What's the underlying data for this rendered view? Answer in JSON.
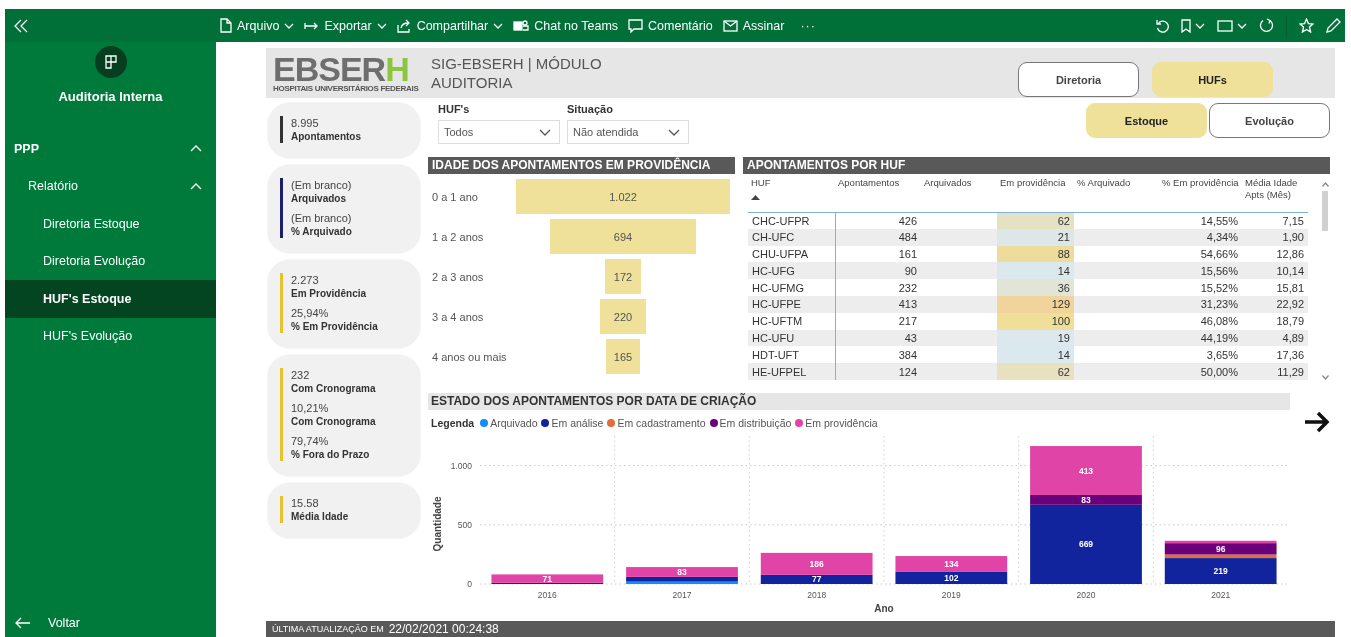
{
  "toolbar": {
    "menus": [
      {
        "kind": "file",
        "label": "Arquivo",
        "dropdown": true
      },
      {
        "kind": "export",
        "label": "Exportar",
        "dropdown": true
      },
      {
        "kind": "share",
        "label": "Compartilhar",
        "dropdown": true
      },
      {
        "kind": "teams",
        "label": "Chat no Teams",
        "dropdown": false
      },
      {
        "kind": "comment",
        "label": "Comentário",
        "dropdown": false
      },
      {
        "kind": "sign",
        "label": "Assinar",
        "dropdown": false
      }
    ],
    "more": "···"
  },
  "sidebar": {
    "title": "Auditoria Interna",
    "nav": [
      {
        "label": "PPP",
        "expanded": true,
        "children": [
          {
            "label": "Relatório",
            "expanded": true,
            "children": [
              {
                "label": "Diretoria Estoque",
                "selected": false
              },
              {
                "label": "Diretoria Evolução",
                "selected": false
              },
              {
                "label": "HUF's Estoque",
                "selected": true
              },
              {
                "label": "HUF's Evolução",
                "selected": false
              }
            ]
          }
        ]
      }
    ],
    "back": "Voltar"
  },
  "report": {
    "header": {
      "logo": {
        "text": "EBSER",
        "accent": "H",
        "subtitle": "HOSPITAIS UNIVERSITÁRIOS FEDERAIS"
      },
      "title": "SIG-EBSERH | MÓDULO AUDITORIA",
      "nav_buttons": [
        {
          "label": "Diretoria",
          "selected": false
        },
        {
          "label": "HUFs",
          "selected": true
        }
      ]
    },
    "cards": [
      {
        "color": "#333333",
        "metrics": [
          {
            "value": "8.995",
            "label": "Apontamentos"
          }
        ]
      },
      {
        "color": "#1c1f6b",
        "metrics": [
          {
            "value": "(Em branco)",
            "label": "Arquivados"
          },
          {
            "value": "(Em branco)",
            "label": "% Arquivado"
          }
        ]
      },
      {
        "color": "#e8c22c",
        "metrics": [
          {
            "value": "2.273",
            "label": "Em Providência"
          },
          {
            "value": "25,94%",
            "label": "% Em Providência"
          }
        ]
      },
      {
        "color": "#e8c22c",
        "metrics": [
          {
            "value": "232",
            "label": "Com Cronograma"
          },
          {
            "value": "10,21%",
            "label": "Com Cronograma"
          },
          {
            "value": "79,74%",
            "label": "% Fora do Prazo"
          }
        ]
      },
      {
        "color": "#e8c22c",
        "metrics": [
          {
            "value": "15.58",
            "label": "Média Idade"
          }
        ]
      }
    ],
    "filters": [
      {
        "label": "HUF's",
        "value": "Todos"
      },
      {
        "label": "Situação",
        "value": "Não atendida"
      }
    ],
    "view_toggle": [
      {
        "label": "Estoque",
        "selected": true
      },
      {
        "label": "Evolução",
        "selected": false
      }
    ],
    "funnel": {
      "title": "IDADE DOS APONTAMENTOS EM PROVIDÊNCIA",
      "stages": [
        {
          "label": "0 a 1 ano",
          "value": "1.022"
        },
        {
          "label": "1 a 2 anos",
          "value": "694"
        },
        {
          "label": "2 a 3 anos",
          "value": "172"
        },
        {
          "label": "3 a 4 anos",
          "value": "220"
        },
        {
          "label": "4 anos ou mais",
          "value": "165"
        }
      ]
    },
    "table": {
      "title": "APONTAMENTOS POR HUF",
      "columns": [
        {
          "label": "HUF",
          "sorted": true
        },
        {
          "label": "Apontamentos",
          "sorted": false
        },
        {
          "label": "Arquivados",
          "sorted": false
        },
        {
          "label": "Em providência",
          "sorted": false
        },
        {
          "label": "% Arquivado",
          "sorted": false
        },
        {
          "label": "% Em providência",
          "sorted": false
        },
        {
          "label": "Média Idade Apts (Mês)",
          "sorted": false
        }
      ],
      "rows": [
        {
          "huf": "CHC-UFPR",
          "apontamentos": "426",
          "em_providencia": "62",
          "color": "#e4e2c2",
          "pct_em_providencia": "14,55%",
          "media_idade": "7,15"
        },
        {
          "huf": "CH-UFC",
          "apontamentos": "484",
          "em_providencia": "21",
          "color": "#dde7e8",
          "pct_em_providencia": "4,34%",
          "media_idade": "1,90"
        },
        {
          "huf": "CHU-UFPA",
          "apontamentos": "161",
          "em_providencia": "88",
          "color": "#eedc9c",
          "pct_em_providencia": "54,66%",
          "media_idade": "12,86"
        },
        {
          "huf": "HC-UFG",
          "apontamentos": "90",
          "em_providencia": "14",
          "color": "#dbe8ee",
          "pct_em_providencia": "15,56%",
          "media_idade": "10,14"
        },
        {
          "huf": "HC-UFMG",
          "apontamentos": "232",
          "em_providencia": "36",
          "color": "#e1e5d8",
          "pct_em_providencia": "15,52%",
          "media_idade": "15,81"
        },
        {
          "huf": "HC-UFPE",
          "apontamentos": "413",
          "em_providencia": "129",
          "color": "#f1d49c",
          "pct_em_providencia": "31,23%",
          "media_idade": "22,92"
        },
        {
          "huf": "HC-UFTM",
          "apontamentos": "217",
          "em_providencia": "100",
          "color": "#efdf98",
          "pct_em_providencia": "46,08%",
          "media_idade": "18,79"
        },
        {
          "huf": "HC-UFU",
          "apontamentos": "43",
          "em_providencia": "19",
          "color": "#dce8ee",
          "pct_em_providencia": "44,19%",
          "media_idade": "4,89"
        },
        {
          "huf": "HDT-UFT",
          "apontamentos": "384",
          "em_providencia": "14",
          "color": "#dbe8ee",
          "pct_em_providencia": "3,65%",
          "media_idade": "17,36"
        },
        {
          "huf": "HE-UFPEL",
          "apontamentos": "124",
          "em_providencia": "62",
          "color": "#e7e1bf",
          "pct_em_providencia": "50,00%",
          "media_idade": "11,29"
        }
      ]
    },
    "timeline": {
      "legend_title": "Legenda",
      "chart_data": {
        "type": "bar",
        "stacked": true,
        "title": "ESTADO DOS APONTAMENTOS POR DATA DE CRIAÇÃO",
        "xlabel": "Ano",
        "ylabel": "Quantidade",
        "categories": [
          "2016",
          "2017",
          "2018",
          "2019",
          "2020",
          "2021"
        ],
        "ylim": [
          0,
          1250
        ],
        "yticks": [
          0,
          500,
          {
            "value": 1000,
            "label": "1.000"
          }
        ],
        "legend": "top",
        "series": [
          {
            "name": "Arquivado",
            "color": "#118dff",
            "values": [
              0,
              20,
              0,
              0,
              0,
              0
            ],
            "value_labels": [
              null,
              null,
              null,
              null,
              null,
              null
            ]
          },
          {
            "name": "Em análise",
            "color": "#12239e",
            "values": [
              10,
              40,
              77,
              102,
              669,
              219
            ],
            "value_labels": [
              null,
              null,
              "77",
              "102",
              "669",
              "219"
            ]
          },
          {
            "name": "Em cadastramento",
            "color": "#e66c37",
            "values": [
              0,
              0,
              0,
              0,
              0,
              30
            ],
            "value_labels": [
              null,
              null,
              null,
              null,
              null,
              null
            ]
          },
          {
            "name": "Em distribuição",
            "color": "#6b007b",
            "values": [
              0,
              0,
              0,
              0,
              83,
              96
            ],
            "value_labels": [
              null,
              null,
              null,
              null,
              "83",
              "96"
            ]
          },
          {
            "name": "Em providência",
            "color": "#e044a7",
            "values": [
              71,
              83,
              186,
              134,
              413,
              20
            ],
            "value_labels": [
              "71",
              "83",
              "186",
              "134",
              "413",
              null
            ]
          }
        ]
      }
    },
    "footer": {
      "label": "ÚLTIMA ATUALIZAÇÃO EM",
      "timestamp": "22/02/2021 00:24:38"
    }
  }
}
